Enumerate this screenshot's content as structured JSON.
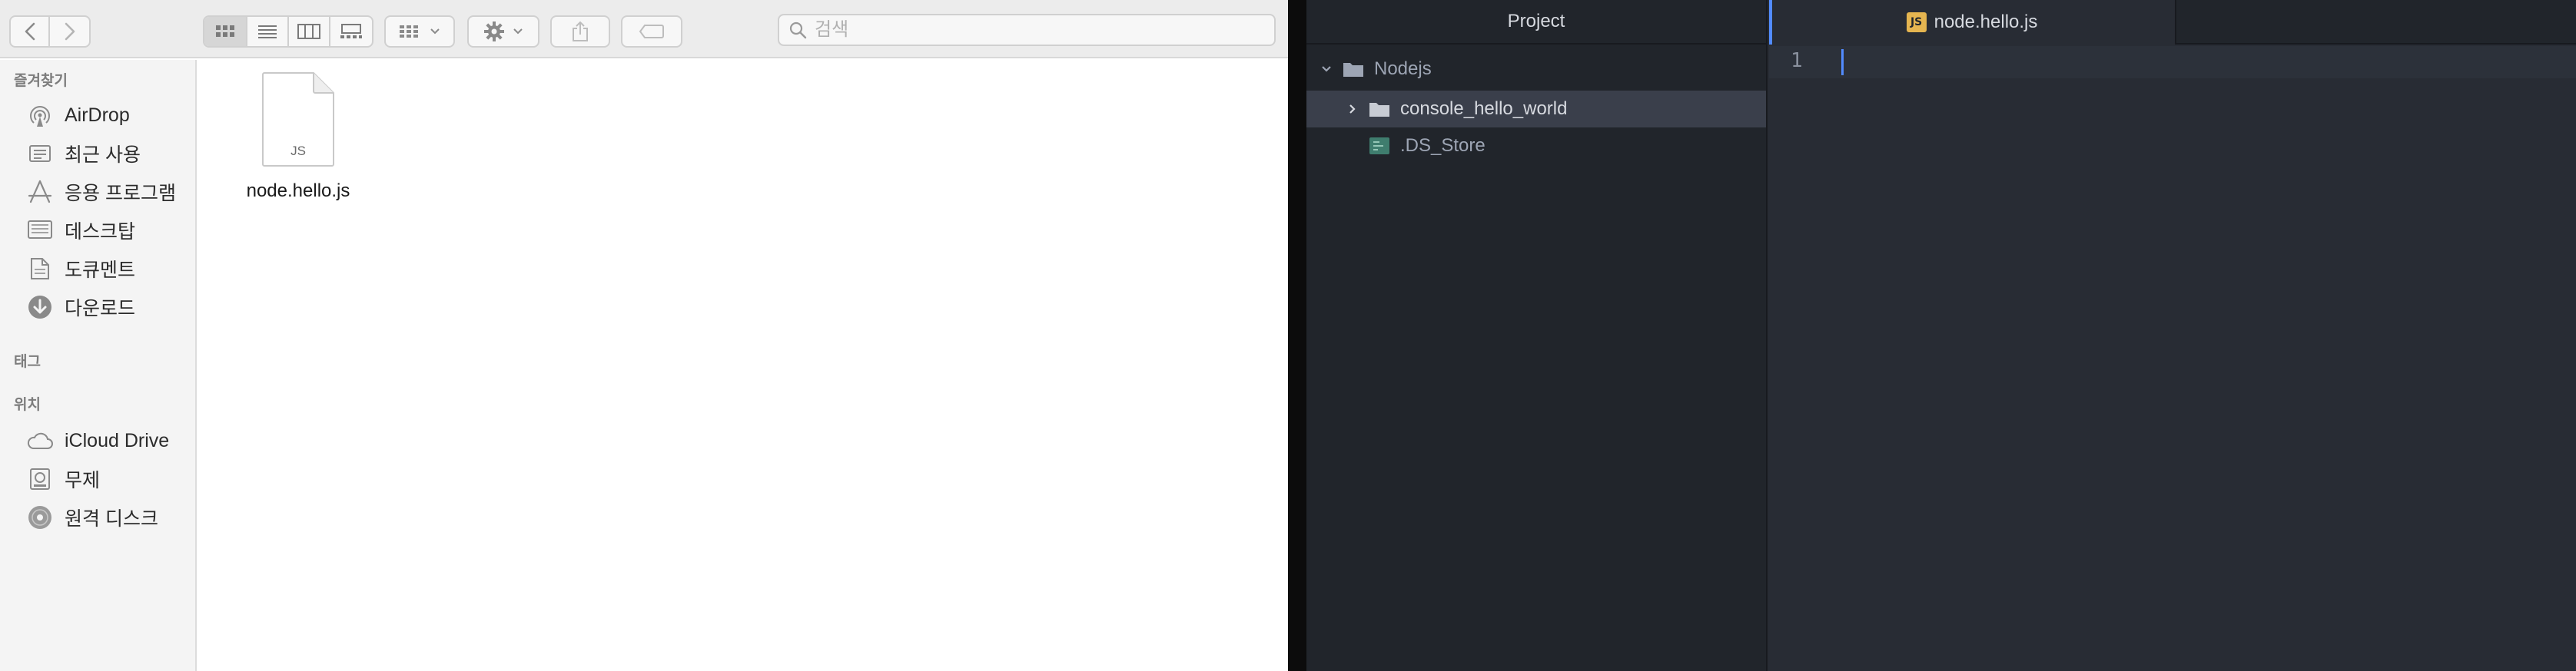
{
  "finder": {
    "search": {
      "placeholder": "검색"
    },
    "sidebar": {
      "sections": [
        {
          "title": "즐겨찾기",
          "items": [
            {
              "label": "AirDrop",
              "icon": "airdrop-icon"
            },
            {
              "label": "최근 사용",
              "icon": "recents-icon"
            },
            {
              "label": "응용 프로그램",
              "icon": "applications-icon"
            },
            {
              "label": "데스크탑",
              "icon": "desktop-icon"
            },
            {
              "label": "도큐멘트",
              "icon": "documents-icon"
            },
            {
              "label": "다운로드",
              "icon": "downloads-icon"
            }
          ]
        },
        {
          "title": "태그",
          "items": []
        },
        {
          "title": "위치",
          "items": [
            {
              "label": "iCloud Drive",
              "icon": "cloud-icon"
            },
            {
              "label": "무제",
              "icon": "disk-icon"
            },
            {
              "label": "원격 디스크",
              "icon": "remote-disc-icon"
            }
          ]
        }
      ]
    },
    "files": [
      {
        "name": "node.hello.js",
        "badge": "JS"
      }
    ]
  },
  "atom": {
    "tree_view": {
      "title": "Project",
      "root": {
        "name": "Nodejs",
        "expanded": true
      },
      "entries": [
        {
          "name": "console_hello_world",
          "type": "folder",
          "expanded": false,
          "selected": true
        },
        {
          "name": ".DS_Store",
          "type": "file",
          "selected": false
        }
      ]
    },
    "tabs": [
      {
        "title": "node.hello.js",
        "badge": "JS",
        "active": true
      }
    ],
    "editor": {
      "line_numbers": [
        "1"
      ]
    }
  },
  "colors": {
    "accent": "#528bff",
    "js_badge": "#e5b550",
    "atom_bg": "#282c34",
    "tree_bg": "#21252b"
  }
}
